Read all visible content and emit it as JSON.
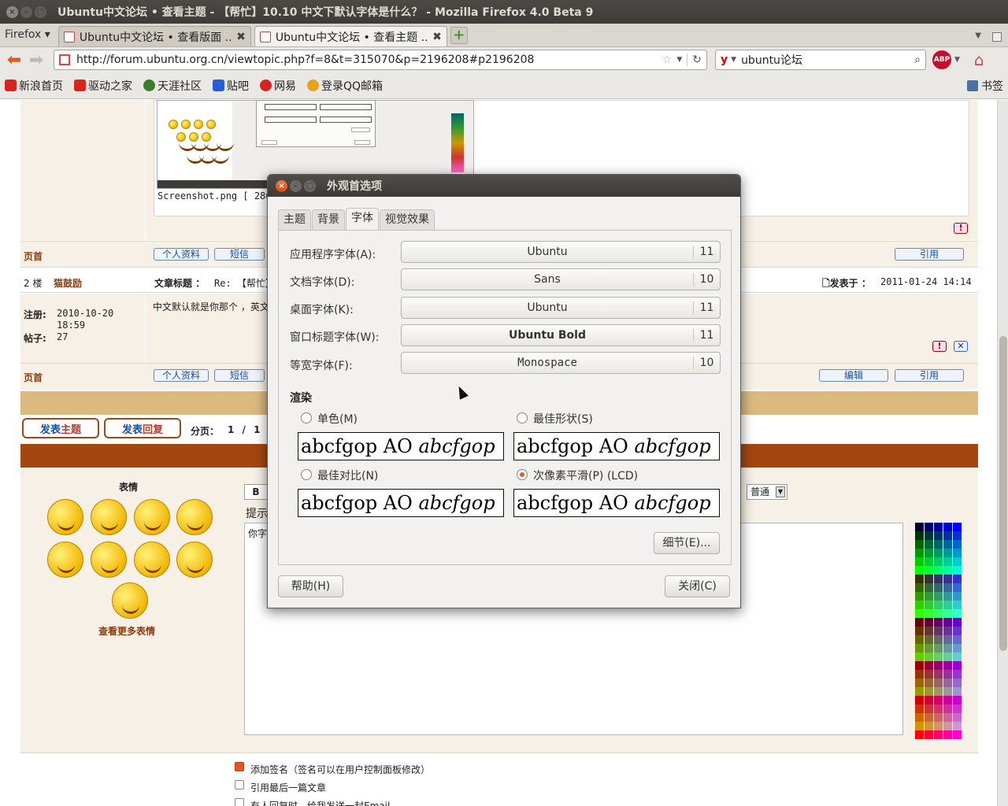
{
  "window": {
    "title": "Ubuntu中文论坛 • 查看主题 - 【帮忙】10.10 中文下默认字体是什么？ - Mozilla Firefox 4.0 Beta 9"
  },
  "tabs": {
    "menu_label": "Firefox",
    "items": [
      {
        "label": "Ubuntu中文论坛 • 查看版面 ..."
      },
      {
        "label": "Ubuntu中文论坛 • 查看主题 ..."
      }
    ]
  },
  "nav": {
    "url": "http://forum.ubuntu.org.cn/viewtopic.php?f=8&t=315070&p=2196208#p2196208",
    "search_value": "ubuntu论坛",
    "abp_label": "ABP"
  },
  "bookmarks": {
    "items": [
      {
        "label": "新浪首页",
        "color": "#d9241c"
      },
      {
        "label": "驱动之家",
        "color": "#d9241c"
      },
      {
        "label": "天涯社区",
        "color": "#3a7d2a"
      },
      {
        "label": "贴吧",
        "color": "#2a5bd7"
      },
      {
        "label": "网易",
        "color": "#d9241c"
      },
      {
        "label": "登录QQ邮箱",
        "color": "#e8a21c"
      }
    ],
    "right_label": "书签"
  },
  "forum": {
    "screenshot_caption": "Screenshot.png [ 286",
    "top_label": "页首",
    "profile_btn": "个人资料",
    "pm_btn": "短信",
    "quote_btn": "引用",
    "edit_btn": "编辑",
    "floor": "2 楼",
    "author": "猫鼓励",
    "subject_label": "文章标题 ：",
    "subject_value": "Re: 【帮忙】",
    "posted_label": "发表于 ：",
    "posted_value": "2011-01-24 14:14",
    "reg_label": "注册:",
    "reg_value": "2010-10-20 18:59",
    "posts_label": "帖子:",
    "posts_value": "27",
    "body_text": "中文默认就是你那个 ，英文",
    "new_topic_a": "发表",
    "new_topic_b": "主题",
    "reply_a": "发表",
    "reply_b": "回复",
    "pages_label": "分页：",
    "pages_value": "1 / 1",
    "emoticons_title": "表情",
    "more_emoticons": "查看更多表情",
    "bold_btn": "B",
    "hint_text": "提示",
    "editor_placeholder": "你字",
    "size_select": "普通",
    "opt_signature": "添加签名（签名可以在用户控制面板修改）",
    "opt_quote_last": "引用最后一篇文章",
    "opt_notify": "有人回复时，给我发送一封Email"
  },
  "dialog": {
    "title": "外观首选项",
    "tabs": [
      "主题",
      "背景",
      "字体",
      "视觉效果"
    ],
    "active_tab": "字体",
    "fonts": [
      {
        "label": "应用程序字体(A):",
        "font": "Ubuntu",
        "size": "11"
      },
      {
        "label": "文档字体(D):",
        "font": "Sans",
        "size": "10"
      },
      {
        "label": "桌面字体(K):",
        "font": "Ubuntu",
        "size": "11"
      },
      {
        "label": "窗口标题字体(W):",
        "font": "Ubuntu Bold",
        "size": "11"
      },
      {
        "label": "等宽字体(F):",
        "font": "Monospace",
        "size": "10"
      }
    ],
    "render_title": "渲染",
    "render_options": [
      {
        "label": "单色(M)",
        "selected": false
      },
      {
        "label": "最佳形状(S)",
        "selected": false
      },
      {
        "label": "最佳对比(N)",
        "selected": false
      },
      {
        "label": "次像素平滑(P) (LCD)",
        "selected": true
      }
    ],
    "sample_plain": "abcfgop AO ",
    "sample_italic": "abcfgop",
    "details_btn": "细节(E)...",
    "help_btn": "帮助(H)",
    "close_btn": "关闭(C)"
  },
  "colors": {
    "accent": "#e95420",
    "forum_bg": "#f7f0e6",
    "gold_bar": "#dbb97f",
    "brown_bar": "#a2470f"
  }
}
